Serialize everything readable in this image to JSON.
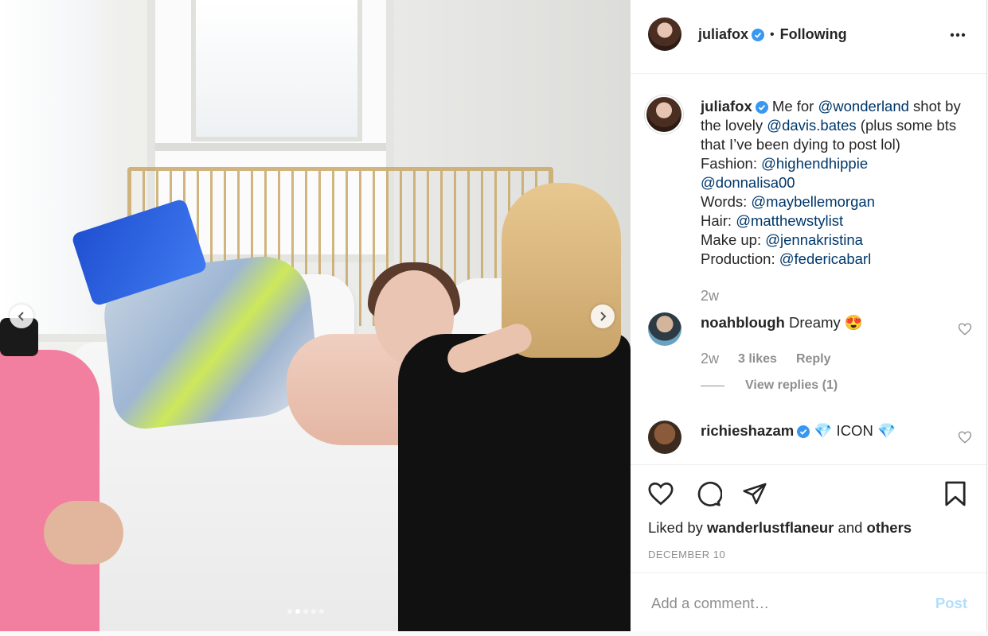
{
  "post": {
    "author": {
      "username": "juliafox",
      "verified": true,
      "follow_state": "Following",
      "separator": "•"
    },
    "more_icon": "more-horizontal-icon",
    "media": {
      "slide_count": 5,
      "active_slide": 2
    },
    "caption": {
      "username": "juliafox",
      "segments": [
        {
          "t": " Me for ",
          "m": false
        },
        {
          "t": "@wonderland",
          "m": true
        },
        {
          "t": " shot by the lovely ",
          "m": false
        },
        {
          "t": "@davis.bates",
          "m": true
        },
        {
          "t": " (plus some bts that I’ve been dying to post lol)",
          "m": false
        },
        {
          "t": "\nFashion: ",
          "m": false
        },
        {
          "t": "@highendhippie",
          "m": true
        },
        {
          "t": "\n",
          "m": false
        },
        {
          "t": "@donnalisa00",
          "m": true
        },
        {
          "t": "\nWords: ",
          "m": false
        },
        {
          "t": "@maybellemorgan",
          "m": true
        },
        {
          "t": "\nHair: ",
          "m": false
        },
        {
          "t": "@matthewstylist",
          "m": true
        },
        {
          "t": "\nMake up: ",
          "m": false
        },
        {
          "t": "@jennakristina",
          "m": true
        },
        {
          "t": "\nProduction: ",
          "m": false
        },
        {
          "t": "@federicabarl",
          "m": true
        }
      ],
      "time": "2w"
    },
    "comments": [
      {
        "username": "noahblough",
        "verified": false,
        "text": "Dreamy 😍",
        "time": "2w",
        "likes": "3 likes",
        "reply": "Reply",
        "view_replies": "View replies (1)"
      },
      {
        "username": "richieshazam",
        "verified": true,
        "text": "💎 ICON 💎"
      }
    ],
    "liked_by": {
      "prefix": "Liked by",
      "user": "wanderlustflaneur",
      "and": "and",
      "others": "others"
    },
    "date": "DECEMBER 10",
    "add_comment": {
      "placeholder": "Add a comment…",
      "post_label": "Post"
    },
    "colors": {
      "link": "#00376b",
      "muted": "#8e8e8e",
      "verified": "#3897f0",
      "post_disabled": "#b2dffc"
    }
  }
}
